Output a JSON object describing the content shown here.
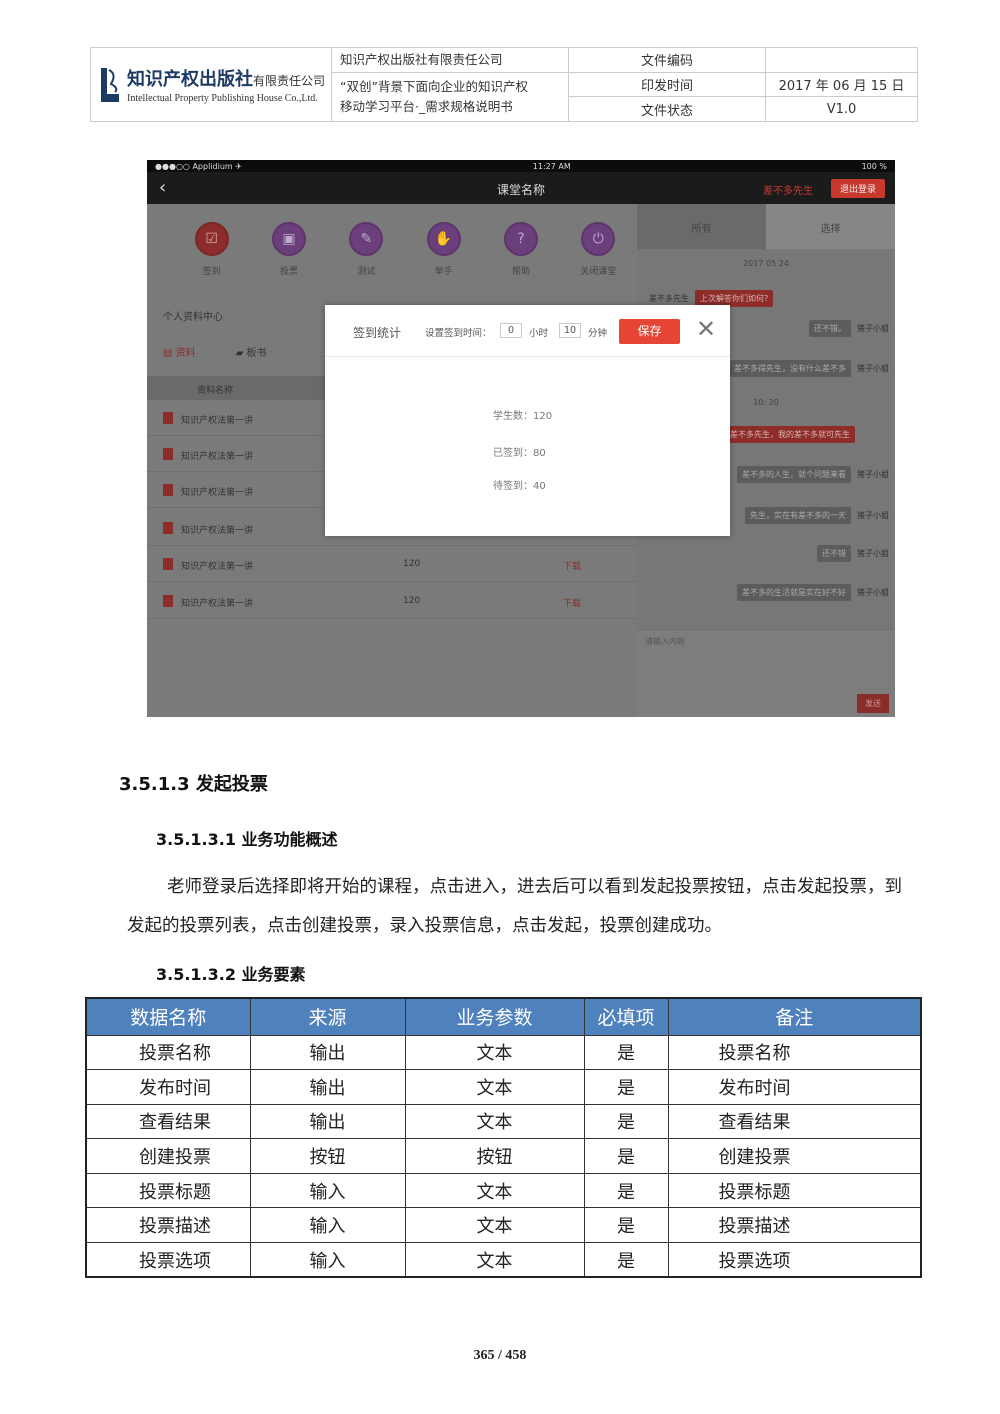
{
  "header": {
    "company_logo_text": "知识产权出版社",
    "company_logo_suffix": "有限责任公司",
    "company_logo_en": "Intellectual Property Publishing House Co.,Ltd.",
    "company_name": "知识产权出版社有限责任公司",
    "doc_title_line1": "“双创”背景下面向企业的知识产权",
    "doc_title_line2": "移动学习平台·_需求规格说明书",
    "label_code": "文件编码",
    "value_code": "",
    "label_date": "印发时间",
    "value_date": "2017 年 06 月 15 日",
    "label_status": "文件状态",
    "value_status": "V1.0"
  },
  "screenshot": {
    "status_left": "●●●○○ Applidium ✈",
    "status_time": "11:27 AM",
    "status_battery": "100 %",
    "nav_title": "课堂名称",
    "nav_user": "差不多先生",
    "nav_logout": "退出登录",
    "functions": [
      {
        "icon": "checkin-icon",
        "label": "签到"
      },
      {
        "icon": "vote-icon",
        "label": "投票"
      },
      {
        "icon": "test-icon",
        "label": "测试"
      },
      {
        "icon": "raise-hand-icon",
        "label": "举手"
      },
      {
        "icon": "help-icon",
        "label": "帮助"
      },
      {
        "icon": "power-icon",
        "label": "关闭课堂"
      }
    ],
    "section_title": "个人资料中心",
    "tab_materials": "资料",
    "tab_board": "板书",
    "table_header_name": "资料名称",
    "files": [
      {
        "name": "知识产权法第一讲",
        "size": "",
        "action": ""
      },
      {
        "name": "知识产权法第一讲",
        "size": "",
        "action": ""
      },
      {
        "name": "知识产权法第一讲",
        "size": "",
        "action": ""
      },
      {
        "name": "知识产权法第一讲",
        "size": "",
        "action": ""
      },
      {
        "name": "知识产权法第一讲",
        "size": "120",
        "action": "下载"
      },
      {
        "name": "知识产权法第一讲",
        "size": "120",
        "action": "下载"
      }
    ],
    "chat_tab_all": "所有",
    "chat_tab_select": "选择",
    "chat_date1": "2017 05 24",
    "chat_date2": "10: 20",
    "chat_messages": [
      {
        "who": "差不多先生",
        "text": "上次解答你们如何?"
      },
      {
        "who": "猪子小姐",
        "text": "还不错。"
      },
      {
        "who": "猪子小姐",
        "text": "差不多得先生，没有什么差不多"
      },
      {
        "who": "",
        "text": "差不多先生，我的差不多就可先生"
      },
      {
        "who": "猪子小姐",
        "text": "差不多的人生，就个问题来看"
      },
      {
        "who": "猪子小姐",
        "text": "先生，实在有差不多的一天"
      },
      {
        "who": "猪子小姐",
        "text": "还不错"
      },
      {
        "who": "猪子小姐",
        "text": "差不多的生活就是实在好不好"
      }
    ],
    "chat_placeholder": "请输入内容",
    "chat_send": "发送",
    "modal": {
      "title": "签到统计",
      "set_label": "设置签到时间：",
      "hours": "0",
      "hours_unit": "小时",
      "minutes": "10",
      "minutes_unit": "分钟",
      "save": "保存",
      "students": "学生数：120",
      "signed": "已签到：80",
      "pending": "待签到：40"
    }
  },
  "doc": {
    "h3": "3.5.1.3 发起投票",
    "h4a": "3.5.1.3.1 业务功能概述",
    "para": "老师登录后选择即将开始的课程，点击进入，进去后可以看到发起投票按钮，点击发起投票，到发起的投票列表，点击创建投票，录入投票信息，点击发起，投票创建成功。",
    "h4b": "3.5.1.3.2 业务要素",
    "table": {
      "headers": [
        "数据名称",
        "来源",
        "业务参数",
        "必填项",
        "备注"
      ],
      "rows": [
        [
          "投票名称",
          "输出",
          "文本",
          "是",
          "投票名称"
        ],
        [
          "发布时间",
          "输出",
          "文本",
          "是",
          "发布时间"
        ],
        [
          "查看结果",
          "输出",
          "文本",
          "是",
          "查看结果"
        ],
        [
          "创建投票",
          "按钮",
          "按钮",
          "是",
          "创建投票"
        ],
        [
          "投票标题",
          "输入",
          "文本",
          "是",
          "投票标题"
        ],
        [
          "投票描述",
          "输入",
          "文本",
          "是",
          "投票描述"
        ],
        [
          "投票选项",
          "输入",
          "文本",
          "是",
          "投票选项"
        ]
      ]
    },
    "page_number": "365 / 458"
  }
}
